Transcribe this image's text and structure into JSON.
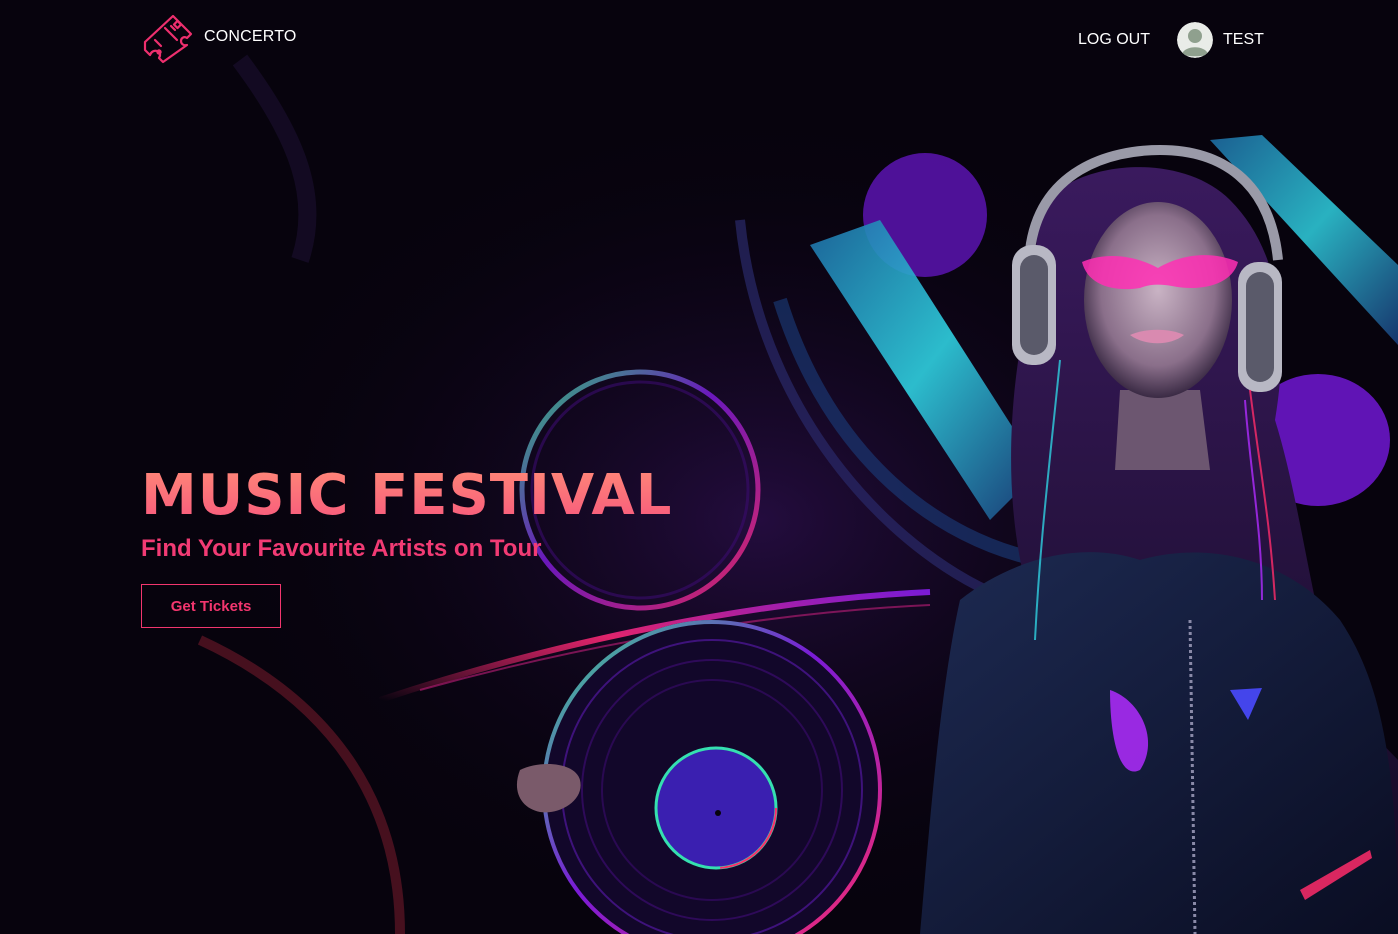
{
  "header": {
    "brand_name": "CONCERTO",
    "logo_icon": "ticket-icon",
    "logout_label": "LOG OUT",
    "user": {
      "name": "TEST",
      "avatar_icon": "default-user-avatar-icon"
    }
  },
  "hero": {
    "title": "MUSIC FESTIVAL",
    "subtitle": "Find Your Favourite Artists on Tour",
    "cta_label": "Get Tickets",
    "background_image": "dj-woman-with-headphones-and-vinyl-record-neon"
  },
  "colors": {
    "background": "#07030d",
    "accent": "#f2366e",
    "title_gradient_top": "#ff8b77",
    "title_gradient_bottom": "#f7547d",
    "text_light": "#ffffff"
  }
}
